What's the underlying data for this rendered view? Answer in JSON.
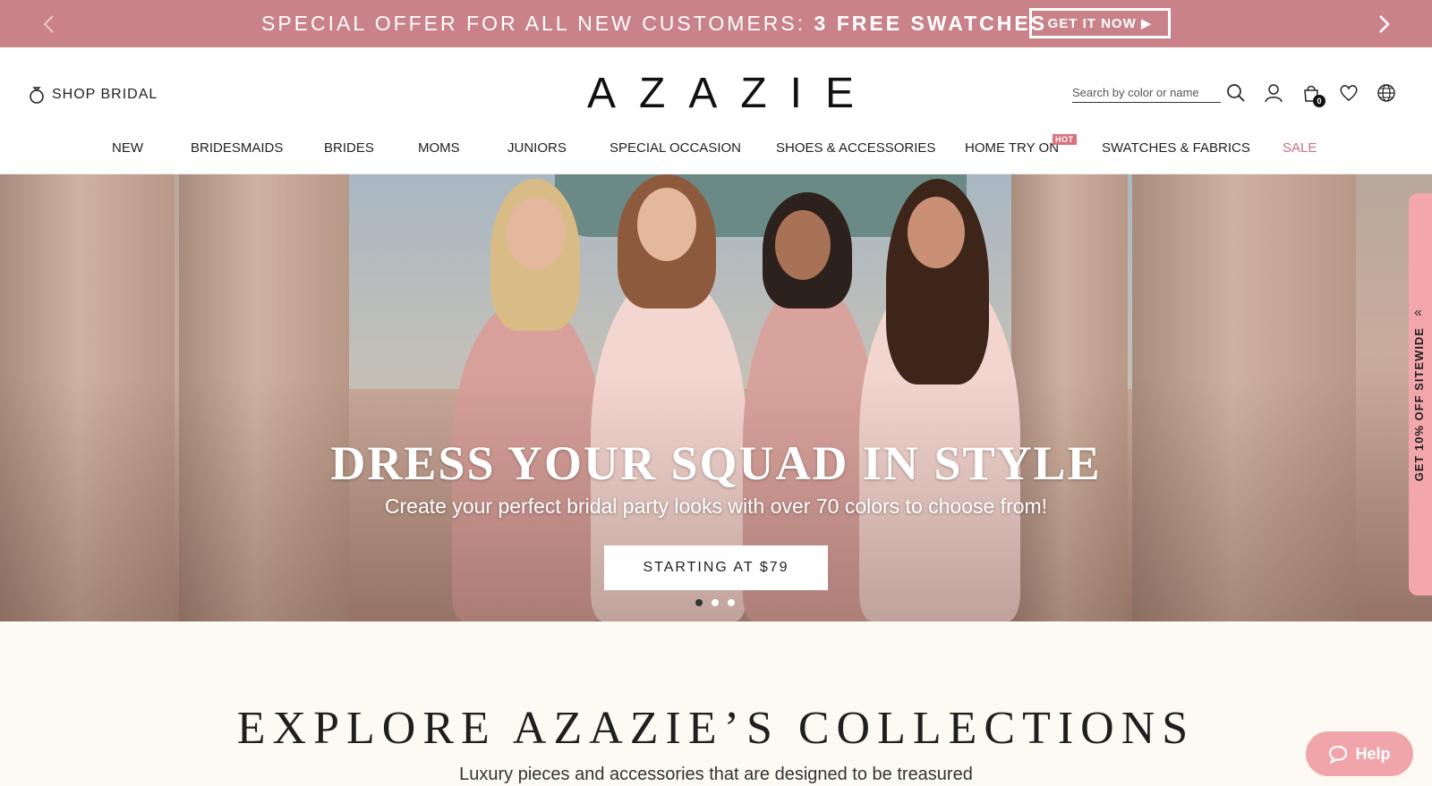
{
  "promo": {
    "text_prefix": "SPECIAL OFFER FOR ALL NEW CUSTOMERS: ",
    "text_bold": "3 FREE SWATCHES",
    "button_label": "GET IT NOW ▶",
    "prev_icon": "chevron-left-icon",
    "next_icon": "chevron-right-icon"
  },
  "header": {
    "shop_bridal_label": "SHOP BRIDAL",
    "logo": "AZAZIE",
    "search_placeholder": "Search by color or name",
    "cart_count": "0",
    "icons": [
      "search-icon",
      "user-icon",
      "cart-icon",
      "heart-icon",
      "globe-icon"
    ]
  },
  "nav": {
    "items": [
      "NEW",
      "BRIDESMAIDS",
      "BRIDES",
      "MOMS",
      "JUNIORS",
      "SPECIAL OCCASION",
      "SHOES & ACCESSORIES",
      "HOME TRY ON",
      "SWATCHES & FABRICS",
      "SALE"
    ],
    "hot_badge": "HOT"
  },
  "hero": {
    "title": "DRESS YOUR SQUAD IN STYLE",
    "subtitle": "Create your perfect bridal party looks with over 70 colors to choose from!",
    "button_label": "STARTING AT $79",
    "slide_count": 3,
    "active_slide": 1
  },
  "side_tab": {
    "label": "GET 10% OFF SITEWIDE"
  },
  "collections": {
    "title": "EXPLORE AZAZIE’S COLLECTIONS",
    "subtitle": "Luxury pieces and accessories that are designed to be treasured"
  },
  "help": {
    "label": "Help"
  },
  "colors": {
    "promo_bg": "#c9828a",
    "accent": "#f0a5ab",
    "sale": "#c9707a"
  }
}
